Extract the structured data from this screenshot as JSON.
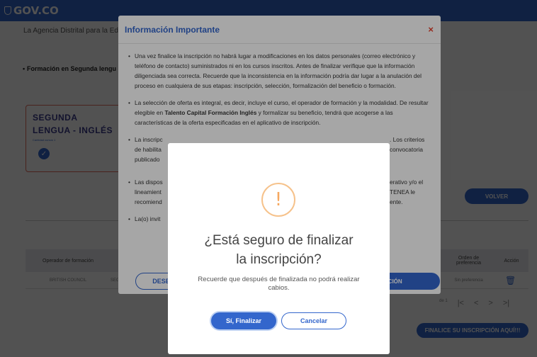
{
  "header": {
    "logo_text": "GOV.CO"
  },
  "page": {
    "intro_text": "La Agencia Distrital para la Educ",
    "bullet_text": "Formación en Segunda lengu",
    "card": {
      "title": "SEGUNDA LENGUA - INGLÉS",
      "subtitle": "Cantidad cursos 1",
      "check_icon": "check-icon"
    },
    "volver_label": "VOLVER",
    "table": {
      "headers": {
        "operador": "Operador de formación",
        "orden": "Orden de preferencia",
        "accion": "Acción"
      },
      "row": {
        "operador": "BRITISH COUNCIL",
        "segunda": "SEGUN",
        "preferencia": "Sin preferencia"
      }
    },
    "pager": {
      "page_label": "de 1",
      "first": "|<",
      "prev": "<",
      "next": ">",
      "last": ">|"
    },
    "finalice_label": "FINALICE SU INSCRIPCIÓN AQUÍ!!!"
  },
  "info_modal": {
    "title": "Información Importante",
    "close": "×",
    "items": [
      "Una vez finalice la inscripción no habrá lugar a modificaciones en los datos personales (correo electrónico y teléfono de contacto) suministrados ni en los cursos inscritos. Antes de finalizar verifique que la información diligenciada sea correcta. Recuerde que la inconsistencia en la información podría dar lugar a la anulación del proceso en cualquiera de sus etapas: inscripción, selección, formalización del beneficio o formación.",
      "La selección de oferta es integral, es decir, incluye el curso, el operador de formación y la modalidad. De resultar elegible en",
      "La inscripc",
      "Las dispos",
      "La(o) invit"
    ],
    "item2_bold": "Talento Capital Formación Inglés",
    "item2_rest": "y formalizar su beneficio, tendrá que acogerse a las características de la oferta especificadas en el aplicativo de inscripción.",
    "item3_tail": ". Los criterios",
    "item3_line2": "de habilita",
    "item3_line2_tail": "convocatoria",
    "item3_line3": "publicado",
    "item4_tail": "erativo y/o el",
    "item4_line2": "lineamient",
    "item4_line2_tail": "TENEA le",
    "item4_line3": "recomiend",
    "item4_line3_tail": "ente.",
    "deseo_label": "DESEO M",
    "finalizar_label": "RIPCIÓN"
  },
  "confirm_modal": {
    "icon": "!",
    "title_line1": "¿Está seguro de finalizar",
    "title_line2": "la inscripción?",
    "text": "Recuerde que después de finalizada no podrá realizar cabios.",
    "confirm_label": "Sí, Finalizar",
    "cancel_label": "Cancelar"
  },
  "colors": {
    "brand": "#3366cc",
    "close": "#e8402c",
    "warning": "#f6a860"
  }
}
